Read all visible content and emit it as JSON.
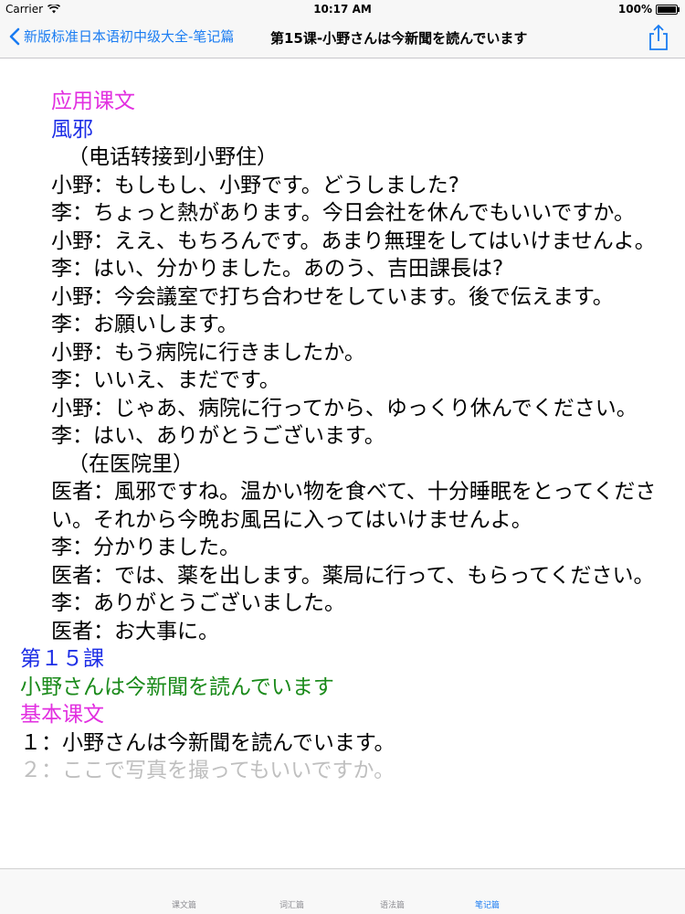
{
  "status_bar": {
    "carrier": "Carrier",
    "time": "10:17 AM",
    "battery": "100%"
  },
  "nav": {
    "back_label": "新版标准日本语初中级大全-笔记篇",
    "title": "第15课-小野さんは今新聞を読んでいます"
  },
  "content": {
    "lines": [
      "应用课文",
      "風邪",
      "（电话转接到小野住）",
      "小野：もしもし、小野です。どうしました?",
      "李：ちょっと熱があります。今日会社を休んでもいいですか。",
      "小野：ええ、もちろんです。あまり無理をしてはいけませんよ。",
      "李：はい、分かりました。あのう、吉田課長は?",
      "小野：今会議室で打ち合わせをしています。後で伝えます。",
      "李：お願いします。",
      "小野：もう病院に行きましたか。",
      "李：いいえ、まだです。",
      "小野：じゃあ、病院に行ってから、ゆっくり休んでください。",
      "李：はい、ありがとうございます。",
      "（在医院里）",
      "医者：風邪ですね。温かい物を食べて、十分睡眠をとってください。それから今晩お風呂に入ってはいけませんよ。",
      "李：分かりました。",
      "医者：では、薬を出します。薬局に行って、もらってください。",
      "李：ありがとうございました。",
      "医者：お大事に。",
      "第１５課",
      "小野さんは今新聞を読んでいます",
      "基本课文",
      "１：小野さんは今新聞を読んでいます。",
      "２：ここで写真を撮ってもいいですか。"
    ]
  },
  "colors": {
    "accent": "#1a7cf2",
    "section_heading": "#e22fe0",
    "title_blue": "#1d2ee6",
    "subtitle_green": "#1a8a1a"
  },
  "tabs": [
    {
      "label": "课文篇"
    },
    {
      "label": "词汇篇"
    },
    {
      "label": "语法篇"
    },
    {
      "label": "笔记篇",
      "active": true
    }
  ]
}
